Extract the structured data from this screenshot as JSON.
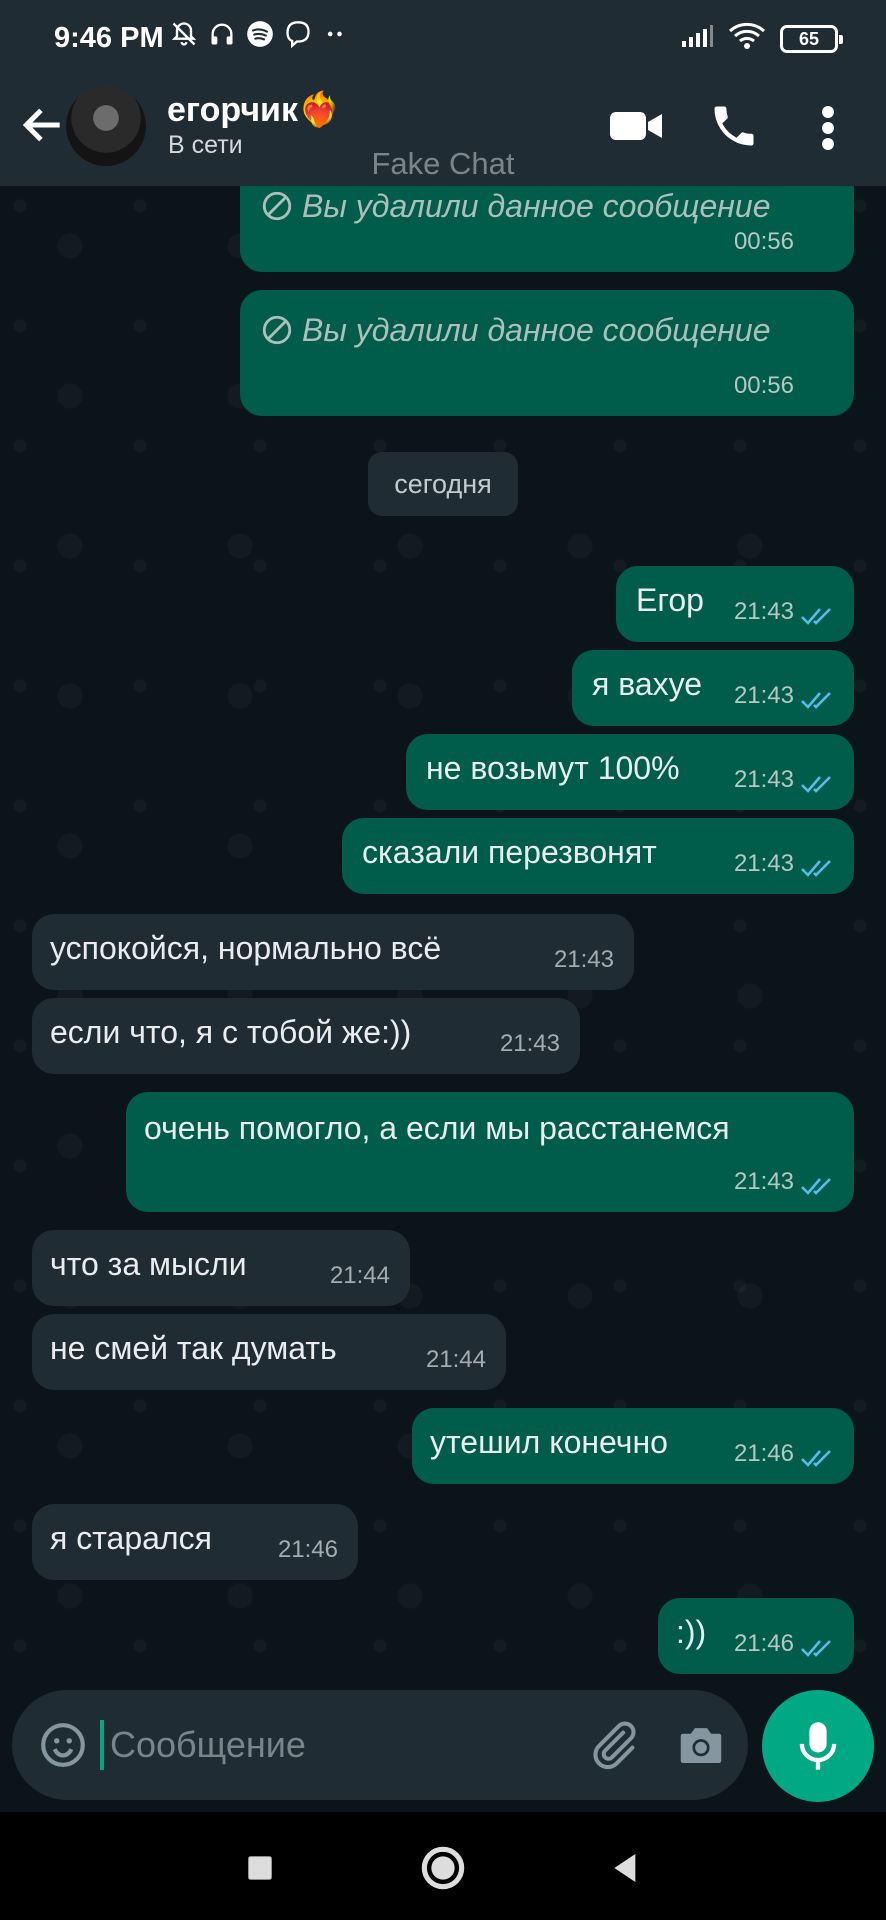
{
  "status_bar": {
    "time": "9:46 PM",
    "battery": "65",
    "icons_left": [
      "mute-bell-icon",
      "headphones-icon",
      "spotify-icon",
      "viber-icon",
      "more-dots-icon"
    ],
    "icons_right": [
      "signal-icon",
      "wifi-icon",
      "battery-icon"
    ]
  },
  "header": {
    "contact_name": "егорчик❤️‍🔥",
    "status": "В сети",
    "watermark": "Fake Chat",
    "icons": [
      "back-arrow-icon",
      "video-call-icon",
      "phone-call-icon",
      "more-vert-icon"
    ]
  },
  "chat": {
    "date_chip": "сегодня",
    "messages": [
      {
        "dir": "out",
        "text": "Вы удалили данное сообщение",
        "time": "00:56",
        "deleted": true
      },
      {
        "dir": "out",
        "text": "Вы удалили данное сообщение",
        "time": "00:56",
        "deleted": true
      },
      {
        "dir": "out",
        "text": "Егор",
        "time": "21:43",
        "read": true
      },
      {
        "dir": "out",
        "text": "я вахуе",
        "time": "21:43",
        "read": true
      },
      {
        "dir": "out",
        "text": "не возьмут 100%",
        "time": "21:43",
        "read": true
      },
      {
        "dir": "out",
        "text": "сказали перезвонят",
        "time": "21:43",
        "read": true
      },
      {
        "dir": "in",
        "text": "успокойся, нормально всё",
        "time": "21:43"
      },
      {
        "dir": "in",
        "text": "если что, я с тобой же:))",
        "time": "21:43"
      },
      {
        "dir": "out",
        "text": "очень помогло, а если мы расстанемся",
        "time": "21:43",
        "read": true
      },
      {
        "dir": "in",
        "text": "что за мысли",
        "time": "21:44"
      },
      {
        "dir": "in",
        "text": "не смей так думать",
        "time": "21:44"
      },
      {
        "dir": "out",
        "text": "утешил конечно",
        "time": "21:46",
        "read": true
      },
      {
        "dir": "in",
        "text": "я старался",
        "time": "21:46"
      },
      {
        "dir": "out",
        "text": ":))",
        "time": "21:46",
        "read": true
      }
    ]
  },
  "composer": {
    "placeholder": "Сообщение",
    "value": ""
  },
  "colors": {
    "outgoing_bubble": "#005c4b",
    "incoming_bubble": "#202c33",
    "accent": "#00a884",
    "read_ticks": "#53bdeb",
    "background": "#0b141a"
  }
}
